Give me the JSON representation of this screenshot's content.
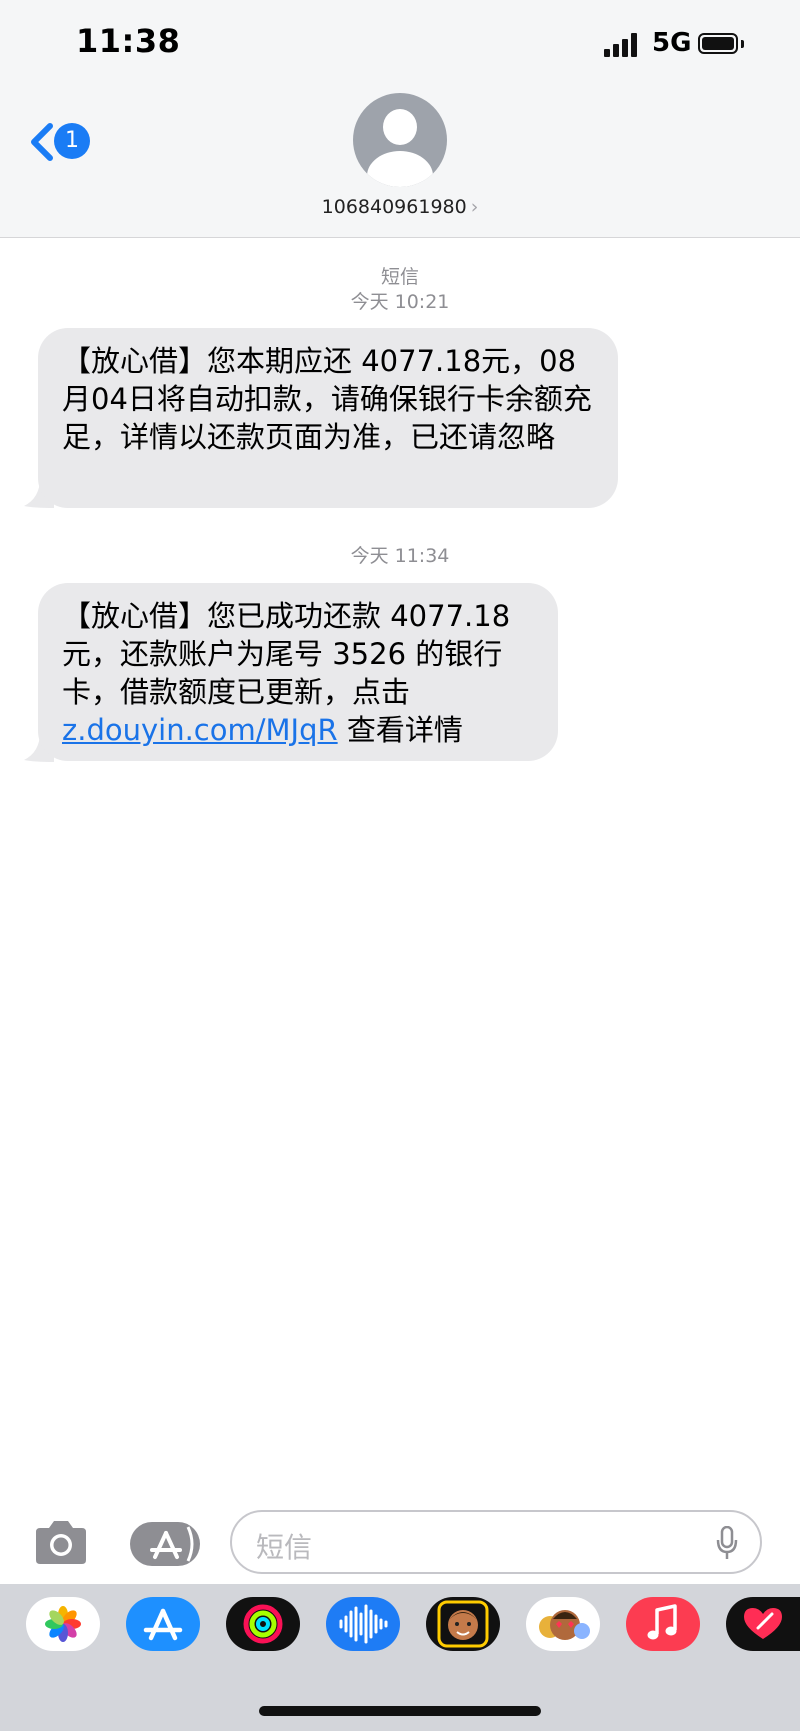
{
  "status_bar": {
    "time": "11:38",
    "network": "5G"
  },
  "nav": {
    "back_count": "1",
    "contact": "106840961980",
    "chevron": "›"
  },
  "conversation": {
    "service_label": "短信",
    "groups": [
      {
        "timestamp": "今天 10:21",
        "message": "【放心借】您本期应还 4077.18元，08月04日将自动扣款，请确保银行卡余额充足，详情以还款页面为准，已还请忽略"
      },
      {
        "timestamp": "今天 11:34",
        "message_before_link": "【放心借】您已成功还款 4077.18元，还款账户为尾号 3526 的银行卡，借款额度已更新，点击",
        "link": "z.douyin.com/MJqR",
        "message_after_link": " 查看详情"
      }
    ]
  },
  "composer": {
    "placeholder": "短信"
  },
  "app_drawer": {
    "apps": [
      "photos-icon",
      "app-store-icon",
      "activity-icon",
      "audio-message-icon",
      "memoji-icon",
      "memoji-stickers-icon",
      "music-icon",
      "digital-touch-icon"
    ]
  },
  "colors": {
    "bubble": "#e9e9eb",
    "accent": "#1a7cf5",
    "link": "#1a73e8",
    "header_bg": "#f5f6f7",
    "drawer_bg": "#d3d5da"
  }
}
